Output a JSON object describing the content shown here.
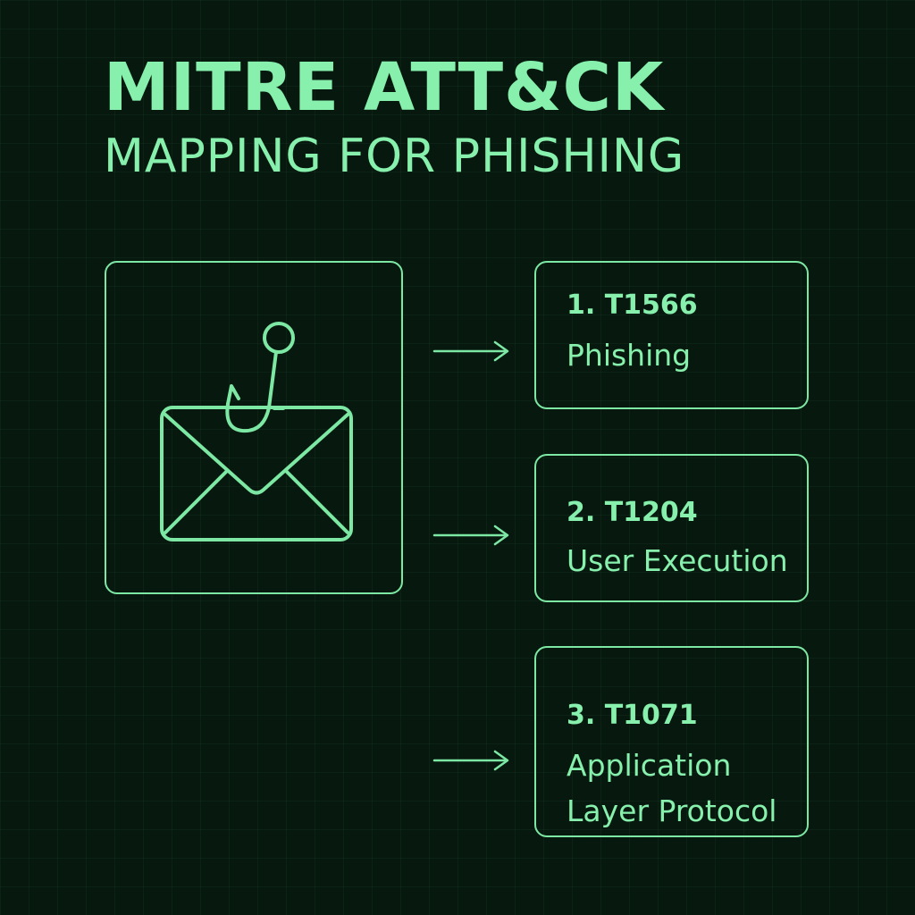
{
  "header": {
    "title": "MITRE ATT&CK",
    "subtitle": "MAPPING FOR PHISHING"
  },
  "icon": {
    "name": "phishing-email-hook-icon"
  },
  "techniques": [
    {
      "id_label": "1. T1566",
      "name": "Phishing"
    },
    {
      "id_label": "2. T1204",
      "name": "User Execution"
    },
    {
      "id_label": "3. T1071",
      "name": "Application Layer Protocol"
    }
  ],
  "colors": {
    "background": "#07190f",
    "accent": "#86f0ac",
    "stroke": "#7de8a3"
  }
}
